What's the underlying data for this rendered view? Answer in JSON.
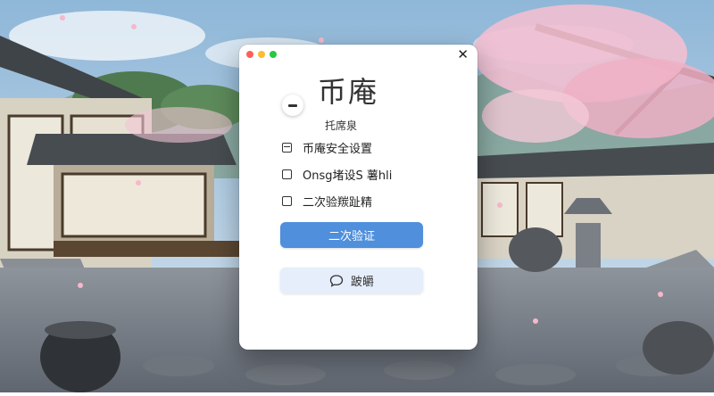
{
  "dialog": {
    "title": "币庵",
    "subtitle": "托席泉",
    "close_glyph": "✕",
    "options": [
      {
        "label": "币庵安全设置"
      },
      {
        "label": "Onsg堵设S 薯hli"
      },
      {
        "label": "二次验羰趾精"
      }
    ],
    "primary_button": "二次验证",
    "secondary_button": "跛皭"
  },
  "colors": {
    "accent": "#4f8fdc",
    "traffic_red": "#ff5f57",
    "traffic_yellow": "#febc2e",
    "traffic_green": "#28c840"
  }
}
